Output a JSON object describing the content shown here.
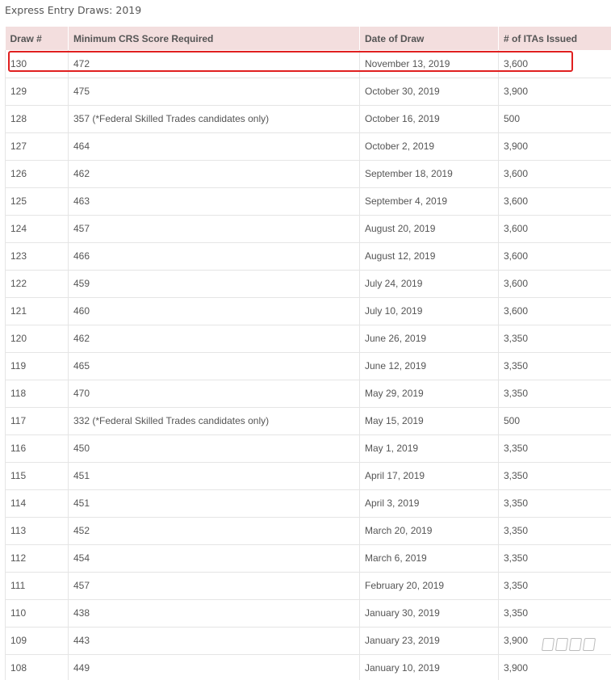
{
  "caption": "Express Entry Draws: 2019",
  "table": {
    "headers": [
      "Draw #",
      "Minimum CRS Score Required",
      "Date of Draw",
      "# of ITAs Issued"
    ],
    "rows": [
      [
        "130",
        "472",
        "November 13, 2019",
        "3,600"
      ],
      [
        "129",
        "475",
        "October 30, 2019",
        "3,900"
      ],
      [
        "128",
        "357 (*Federal Skilled Trades candidates only)",
        "October 16, 2019",
        "500"
      ],
      [
        "127",
        "464",
        "October 2, 2019",
        "3,900"
      ],
      [
        "126",
        "462",
        "September 18, 2019",
        "3,600"
      ],
      [
        "125",
        "463",
        "September 4, 2019",
        "3,600"
      ],
      [
        "124",
        "457",
        "August 20, 2019",
        "3,600"
      ],
      [
        "123",
        "466",
        "August 12, 2019",
        "3,600"
      ],
      [
        "122",
        "459",
        "July 24, 2019",
        "3,600"
      ],
      [
        "121",
        "460",
        "July 10, 2019",
        "3,600"
      ],
      [
        "120",
        "462",
        "June 26, 2019",
        "3,350"
      ],
      [
        "119",
        "465",
        "June 12, 2019",
        "3,350"
      ],
      [
        "118",
        "470",
        "May 29, 2019",
        "3,350"
      ],
      [
        "117",
        "332 (*Federal Skilled Trades candidates only)",
        "May 15, 2019",
        "500"
      ],
      [
        "116",
        "450",
        "May 1, 2019",
        "3,350"
      ],
      [
        "115",
        "451",
        "April 17, 2019",
        "3,350"
      ],
      [
        "114",
        "451",
        "April 3, 2019",
        "3,350"
      ],
      [
        "113",
        "452",
        "March 20, 2019",
        "3,350"
      ],
      [
        "112",
        "454",
        "March 6, 2019",
        "3,350"
      ],
      [
        "111",
        "457",
        "February 20, 2019",
        "3,350"
      ],
      [
        "110",
        "438",
        "January 30, 2019",
        "3,350"
      ],
      [
        "109",
        "443",
        "January 23, 2019",
        "3,900"
      ],
      [
        "108",
        "449",
        "January 10, 2019",
        "3,900"
      ]
    ]
  },
  "colors": {
    "header_bg": "#f3dede",
    "highlight": "#e02020",
    "text": "#555555",
    "grid": "#e5e5e5"
  }
}
